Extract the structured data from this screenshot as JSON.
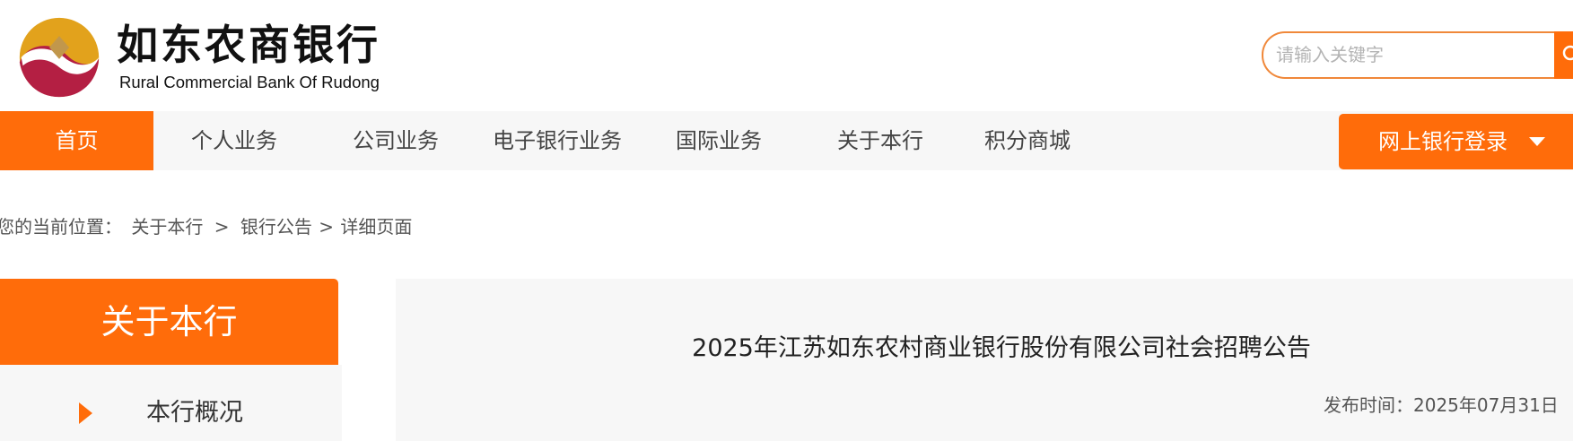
{
  "header": {
    "brand_cn": "如东农商银行",
    "brand_en": "Rural Commercial Bank Of Rudong",
    "search_placeholder": "请输入关键字"
  },
  "nav": {
    "items": [
      {
        "label": "首页",
        "active": true
      },
      {
        "label": "个人业务",
        "active": false
      },
      {
        "label": "公司业务",
        "active": false
      },
      {
        "label": "电子银行业务",
        "active": false
      },
      {
        "label": "国际业务",
        "active": false
      },
      {
        "label": "关于本行",
        "active": false
      },
      {
        "label": "积分商城",
        "active": false
      }
    ],
    "login_label": "网上银行登录"
  },
  "breadcrumb": {
    "prefix": "您的当前位置：",
    "items": [
      "关于本行",
      "银行公告",
      "详细页面"
    ],
    "sep1": ">",
    "sep2": ">"
  },
  "sidebar": {
    "title": "关于本行",
    "items": [
      {
        "label": "本行概况"
      }
    ]
  },
  "article": {
    "title": "2025年江苏如东农村商业银行股份有限公司社会招聘公告",
    "publish_label": "发布时间：",
    "publish_date": "2025年07月31日"
  },
  "colors": {
    "accent": "#ff6c0a",
    "logo_gold": "#e2a21c",
    "logo_crimson": "#b41f43",
    "nav_bg": "#f7f7f7"
  }
}
